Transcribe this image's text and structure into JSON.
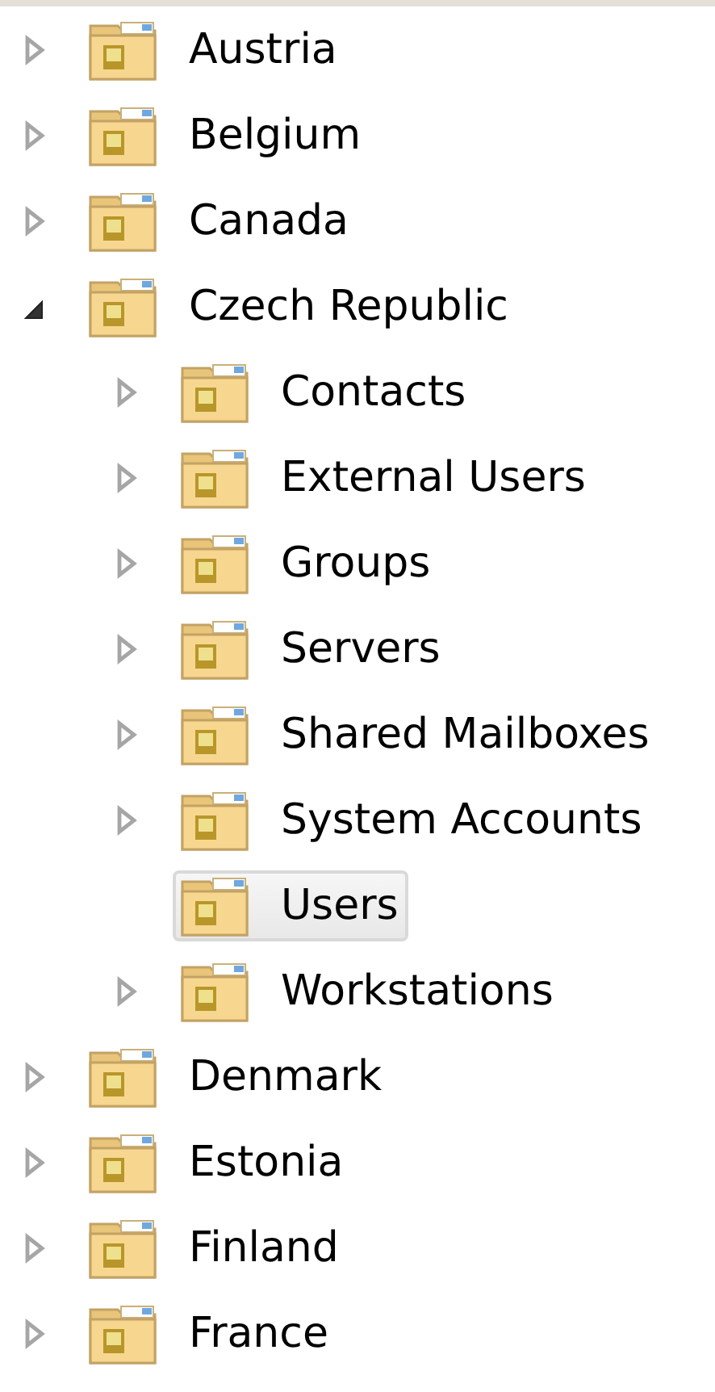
{
  "tree": {
    "items": [
      {
        "label": "Austria",
        "kind": "branch",
        "expanded": false,
        "selected": false
      },
      {
        "label": "Belgium",
        "kind": "branch",
        "expanded": false,
        "selected": false
      },
      {
        "label": "Canada",
        "kind": "branch",
        "expanded": false,
        "selected": false
      },
      {
        "label": "Czech Republic",
        "kind": "branch",
        "expanded": true,
        "selected": false,
        "children": [
          {
            "label": "Contacts",
            "kind": "branch",
            "expanded": false,
            "selected": false
          },
          {
            "label": "External Users",
            "kind": "branch",
            "expanded": false,
            "selected": false
          },
          {
            "label": "Groups",
            "kind": "branch",
            "expanded": false,
            "selected": false
          },
          {
            "label": "Servers",
            "kind": "branch",
            "expanded": false,
            "selected": false
          },
          {
            "label": "Shared Mailboxes",
            "kind": "branch",
            "expanded": false,
            "selected": false
          },
          {
            "label": "System Accounts",
            "kind": "branch",
            "expanded": false,
            "selected": false
          },
          {
            "label": "Users",
            "kind": "leaf",
            "selected": true
          },
          {
            "label": "Workstations",
            "kind": "branch",
            "expanded": false,
            "selected": false
          }
        ]
      },
      {
        "label": "Denmark",
        "kind": "branch",
        "expanded": false,
        "selected": false
      },
      {
        "label": "Estonia",
        "kind": "branch",
        "expanded": false,
        "selected": false
      },
      {
        "label": "Finland",
        "kind": "branch",
        "expanded": false,
        "selected": false
      },
      {
        "label": "France",
        "kind": "branch",
        "expanded": false,
        "selected": false
      }
    ]
  }
}
